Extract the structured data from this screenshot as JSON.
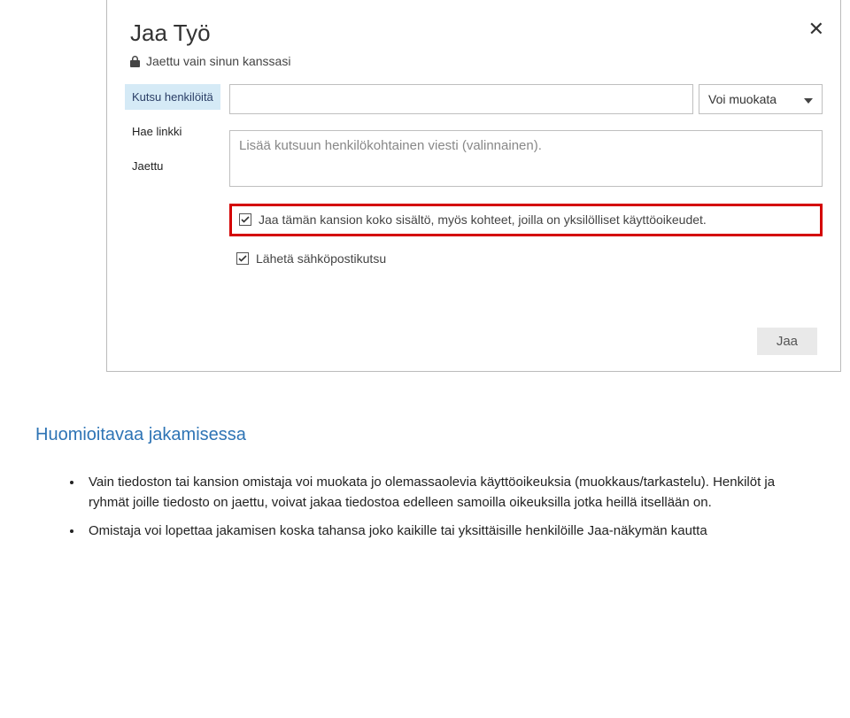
{
  "dialog": {
    "title": "Jaa Työ",
    "status": "Jaettu vain sinun kanssasi",
    "tabs": {
      "invite": "Kutsu henkilöitä",
      "getLink": "Hae linkki",
      "shared": "Jaettu"
    },
    "peoplePlaceholder": "",
    "permission": "Voi muokata",
    "messagePlaceholder": "Lisää kutsuun henkilökohtainen viesti (valinnainen).",
    "checkShareAll": "Jaa tämän kansion koko sisältö, myös kohteet, joilla on yksilölliset käyttöoikeudet.",
    "checkSendEmail": "Lähetä sähköpostikutsu",
    "submit": "Jaa"
  },
  "doc": {
    "heading": "Huomioitavaa jakamisessa",
    "bullets": [
      "Vain tiedoston tai kansion omistaja voi muokata jo olemassaolevia käyttöoikeuksia (muokkaus/tarkastelu). Henkilöt ja ryhmät joille tiedosto on jaettu, voivat jakaa tiedostoa edelleen samoilla oikeuksilla jotka heillä itsellään on.",
      "Omistaja voi lopettaa jakamisen koska tahansa joko kaikille tai yksittäisille henkilöille Jaa-näkymän kautta"
    ]
  }
}
